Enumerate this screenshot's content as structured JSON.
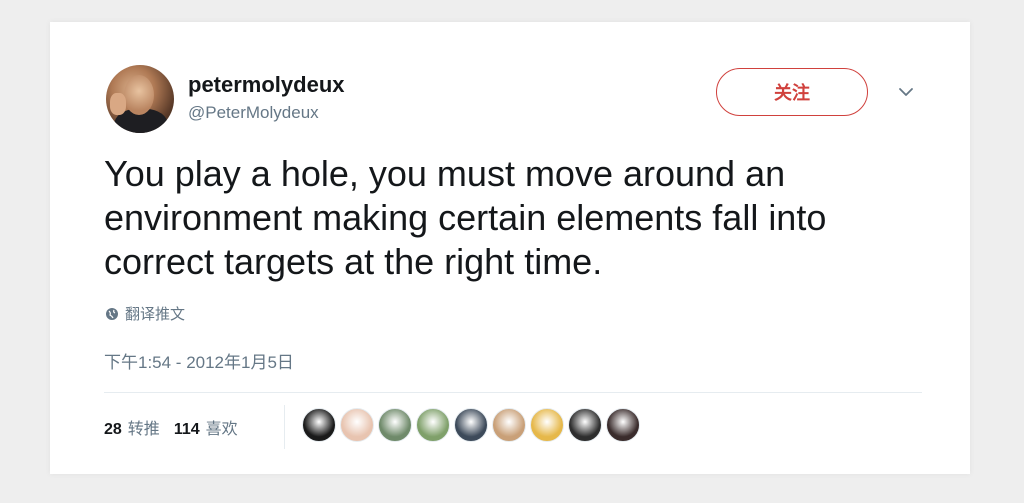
{
  "user": {
    "display_name": "petermolydeux",
    "handle": "@PeterMolydeux",
    "avatar_icon": "profile-photo"
  },
  "follow_button": {
    "label": "关注",
    "color": "#d0413d"
  },
  "menu": {
    "icon": "chevron-down-icon"
  },
  "tweet": {
    "text": "You play a hole, you must move around an environment making certain elements fall into correct targets at the right time.",
    "translate_label": "翻译推文",
    "timestamp": "下午1:54 - 2012年1月5日"
  },
  "stats": {
    "retweets_count": "28",
    "retweets_label": "转推",
    "likes_count": "114",
    "likes_label": "喜欢"
  },
  "likers": [
    {
      "name": "liker-1",
      "bg": "#1a1a1a"
    },
    {
      "name": "liker-2",
      "bg": "#e8c4b0"
    },
    {
      "name": "liker-3",
      "bg": "#6f8a6a"
    },
    {
      "name": "liker-4",
      "bg": "#7fa06a"
    },
    {
      "name": "liker-5",
      "bg": "#3d4a5a"
    },
    {
      "name": "liker-6",
      "bg": "#c9a078"
    },
    {
      "name": "liker-7",
      "bg": "#e6b84a"
    },
    {
      "name": "liker-8",
      "bg": "#2e2e2e"
    },
    {
      "name": "liker-9",
      "bg": "#3a2c2c"
    }
  ]
}
